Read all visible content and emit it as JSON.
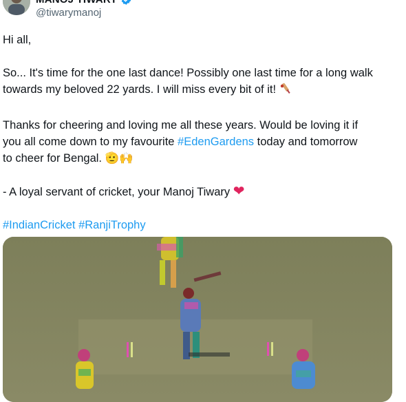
{
  "tweet": {
    "author": {
      "name": "MANOJ TIWARY",
      "handle": "@tiwarymanoj"
    },
    "text": {
      "greeting": "Hi all,",
      "p1_line1": "So... It's time for the one last dance! Possibly one last time for a long walk",
      "p1_line2": "towards my beloved 22 yards. I will miss every bit of it!",
      "p2_line1": "Thanks for cheering and loving me all these years. Would be loving it if",
      "p2_line2_before": "you all come down to my favourite ",
      "p2_hashtag": "#EdenGardens",
      "p2_line2_after": " today and tomorrow",
      "p2_line3": "to cheer for Bengal.",
      "p2_emojis": "🫡🙌",
      "signoff": "- A loyal servant of cricket, your Manoj Tiwary",
      "heart": "❤",
      "hashtags": [
        "#IndianCricket",
        "#RanjiTrophy"
      ]
    },
    "colors": {
      "link": "#1d9bf0",
      "verified": "#1d9bf0",
      "heart": "#e0245e",
      "secondary_text": "#536471"
    },
    "icons": [
      "verified-badge-icon",
      "more-options-icon",
      "cricket-bat-icon"
    ],
    "media": {
      "type": "image",
      "subject": "cricket-match-video-frame"
    }
  }
}
